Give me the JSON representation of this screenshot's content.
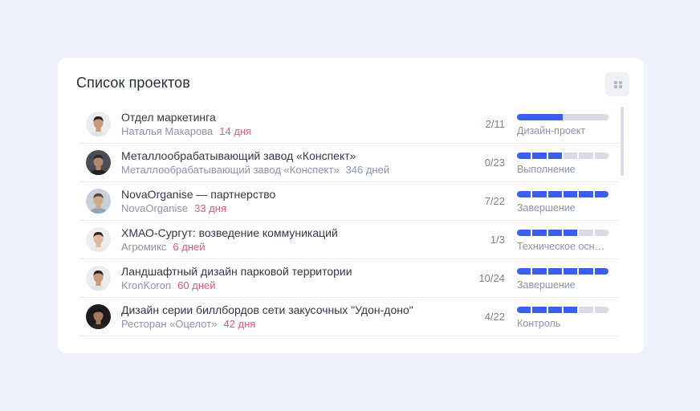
{
  "card": {
    "title": "Список проектов",
    "menu_icon": "grid-dots-icon"
  },
  "colors": {
    "accent": "#3a61e4",
    "danger": "#f0566a",
    "muted": "#8a93ad",
    "track": "#d7dbe8"
  },
  "projects": [
    {
      "name": "Отдел маркетинга",
      "client": "Наталья Макарова",
      "days": "14 дня",
      "days_color": "#f0566a",
      "count": "2/11",
      "progress_segments": 2,
      "progress_filled": 1,
      "stage": "Дизайн-проект",
      "avatar": {
        "bg": "#e9ecf1",
        "skin": "#c99a78",
        "hair": "#2b2420",
        "shirt": "#dfe3e8",
        "face": "man-glasses-icon"
      }
    },
    {
      "name": "Металлообрабатывающий завод «Конспект»",
      "client": "Металлообрабатывающий завод «Конспект»",
      "days": "346 дней",
      "days_color": "#8a93ad",
      "count": "0/23",
      "progress_segments": 6,
      "progress_filled": 3,
      "stage": "Выполнение",
      "avatar": {
        "bg": "#4a4f57",
        "skin": "#b8876a",
        "hair": "#2c2a28",
        "shirt": "#1f2328",
        "face": "man-dark-icon"
      }
    },
    {
      "name": "NovaOrganise — партнерство",
      "client": "NovaOrganise",
      "days": "33 дня",
      "days_color": "#f0566a",
      "count": "7/22",
      "progress_segments": 6,
      "progress_filled": 6,
      "stage": "Завершение",
      "avatar": {
        "bg": "#c8d0da",
        "skin": "#d3a98a",
        "hair": "#5a4536",
        "shirt": "#8fa3b8",
        "face": "man-smile-icon"
      }
    },
    {
      "name": "ХМАО-Сургут: возведение коммуникаций",
      "client": "Агромикс",
      "days": "6 дней",
      "days_color": "#f0566a",
      "count": "1/3",
      "progress_segments": 6,
      "progress_filled": 4,
      "stage": "Техническое основание",
      "avatar": {
        "bg": "#eceef2",
        "skin": "#e2b9a0",
        "hair": "#3b241c",
        "shirt": "#f1e6e0",
        "face": "woman-icon"
      }
    },
    {
      "name": "Ландшафтный дизайн парковой территории",
      "client": "KronKoron",
      "days": "60 дней",
      "days_color": "#f0566a",
      "count": "10/24",
      "progress_segments": 6,
      "progress_filled": 6,
      "stage": "Завершение",
      "avatar": {
        "bg": "#e9ecf1",
        "skin": "#c99a78",
        "hair": "#2b2420",
        "shirt": "#dfe3e8",
        "face": "man-glasses-icon"
      }
    },
    {
      "name": "Дизайн серии биллбордов сети закусочных \"Удон-доно\"",
      "client": "Ресторан «Оцелот»",
      "days": "42 дня",
      "days_color": "#f0566a",
      "count": "4/22",
      "progress_segments": 6,
      "progress_filled": 4,
      "stage": "Контроль",
      "avatar": {
        "bg": "#1e1b1a",
        "skin": "#a6785c",
        "hair": "#141212",
        "shirt": "#2a2624",
        "face": "man-dark-icon"
      }
    }
  ]
}
